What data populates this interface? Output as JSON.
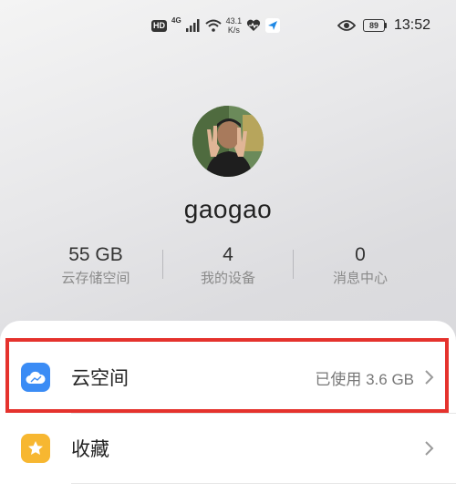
{
  "status_bar": {
    "hd_badge": "HD",
    "network_type": "4G",
    "speed_value": "43.1",
    "speed_unit": "K/s",
    "battery_level": "89",
    "time": "13:52",
    "icons": [
      "hd-icon",
      "signal-icon",
      "wifi-icon",
      "heart-icon",
      "location-arrow-icon",
      "eye-icon",
      "battery-icon"
    ]
  },
  "profile": {
    "username": "gaogao",
    "avatar_icon": "avatar"
  },
  "stats": [
    {
      "value": "55 GB",
      "label": "云存储空间"
    },
    {
      "value": "4",
      "label": "我的设备"
    },
    {
      "value": "0",
      "label": "消息中心"
    }
  ],
  "menu": {
    "items": [
      {
        "label": "云空间",
        "value": "已使用 3.6 GB",
        "icon": "cloud-icon",
        "icon_color": "#3b8cf5"
      },
      {
        "label": "收藏",
        "value": "",
        "icon": "star-icon",
        "icon_color": "#f7b731"
      }
    ]
  },
  "colors": {
    "highlight_border": "#e5322d",
    "cloud_icon_bg": "#3b8cf5",
    "star_icon_bg": "#f7b731"
  }
}
